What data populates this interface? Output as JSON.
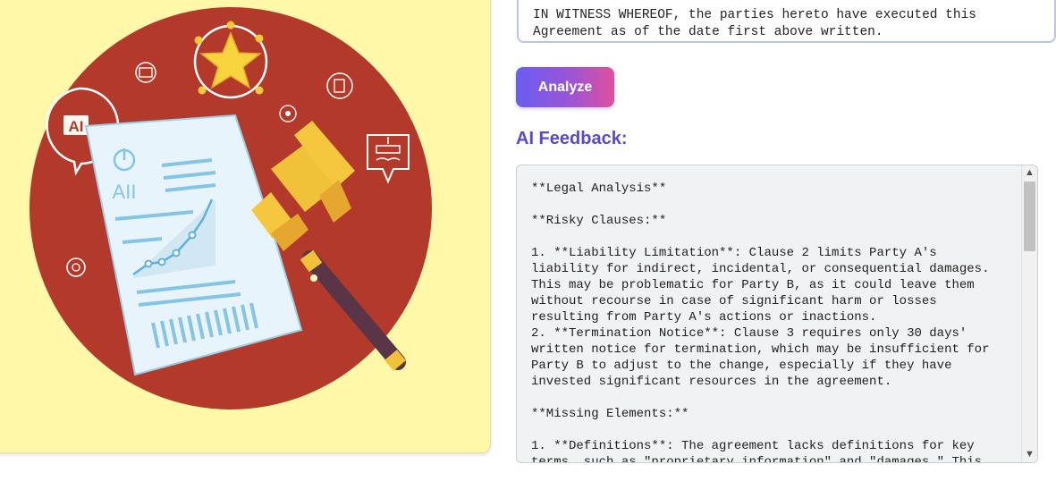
{
  "contract_input": {
    "text": "IN WITNESS WHEREOF, the parties hereto have executed this\nAgreement as of the date first above written."
  },
  "illustration": {
    "chat_badge_text": "AI",
    "document_text": "AII"
  },
  "analyze_button": {
    "label": "Analyze"
  },
  "feedback": {
    "heading": "AI Feedback:",
    "text": "**Legal Analysis**\n\n**Risky Clauses:**\n\n1. **Liability Limitation**: Clause 2 limits Party A's\nliability for indirect, incidental, or consequential damages.\nThis may be problematic for Party B, as it could leave them\nwithout recourse in case of significant harm or losses\nresulting from Party A's actions or inactions.\n2. **Termination Notice**: Clause 3 requires only 30 days'\nwritten notice for termination, which may be insufficient for\nParty B to adjust to the change, especially if they have\ninvested significant resources in the agreement.\n\n**Missing Elements:**\n\n1. **Definitions**: The agreement lacks definitions for key\nterms, such as \"proprietary information\" and \"damages.\" This"
  },
  "scrollbar": {
    "up_glyph": "▲",
    "down_glyph": "▼"
  },
  "colors": {
    "hero_background": "#fff8a8",
    "circle": "#b33a2b",
    "accent_heading": "#5a47d8",
    "button_gradient_start": "#6a5cf2",
    "button_gradient_end": "#e0509c"
  }
}
